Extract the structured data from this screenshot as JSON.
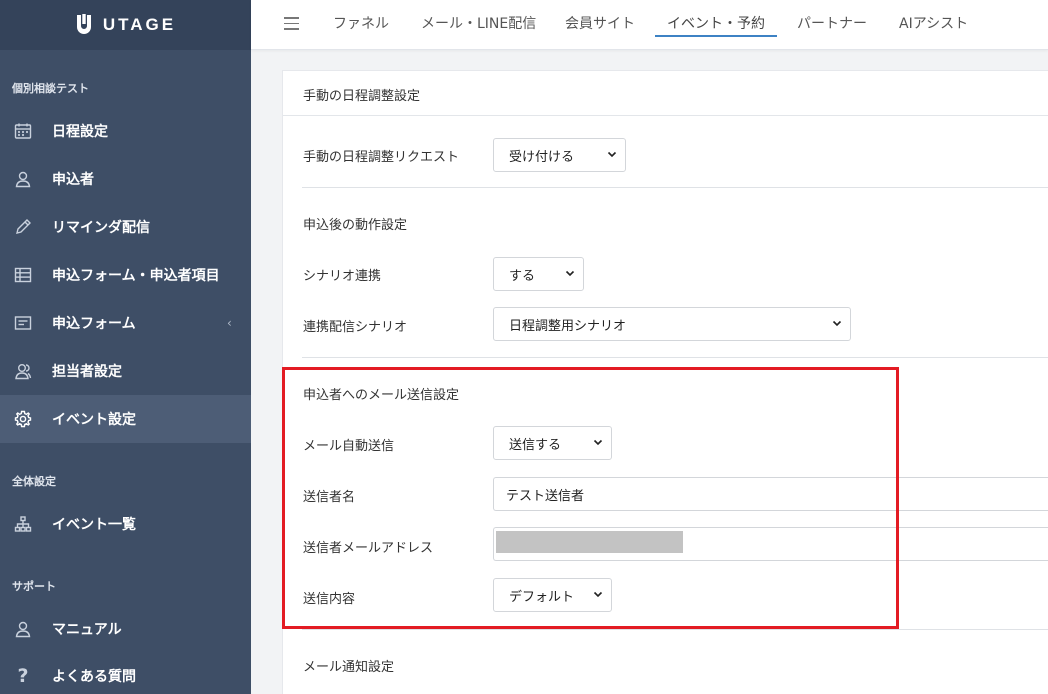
{
  "brand": {
    "name": "UTAGE"
  },
  "sidebar": {
    "sections": [
      {
        "title": "個別相談テスト"
      },
      {
        "title": "全体設定"
      },
      {
        "title": "サポート"
      }
    ],
    "items": [
      {
        "label": "日程設定",
        "icon": "calendar-icon"
      },
      {
        "label": "申込者",
        "icon": "user-icon"
      },
      {
        "label": "リマインダ配信",
        "icon": "pencil-icon"
      },
      {
        "label": "申込フォーム・申込者項目",
        "icon": "table-icon"
      },
      {
        "label": "申込フォーム",
        "icon": "form-icon",
        "chevron": "‹"
      },
      {
        "label": "担当者設定",
        "icon": "users-icon"
      },
      {
        "label": "イベント設定",
        "icon": "gear-icon",
        "active": true
      },
      {
        "label": "イベント一覧",
        "icon": "sitemap-icon"
      },
      {
        "label": "マニュアル",
        "icon": "user-icon"
      },
      {
        "label": "よくある質問",
        "icon": "question-icon"
      }
    ]
  },
  "topnav": {
    "tabs": [
      {
        "label": "ファネル"
      },
      {
        "label": "メール・LINE配信"
      },
      {
        "label": "会員サイト"
      },
      {
        "label": "イベント・予約",
        "active": true
      },
      {
        "label": "パートナー"
      },
      {
        "label": "AIアシスト"
      }
    ]
  },
  "card": {
    "title": "手動の日程調整設定",
    "manual_request": {
      "label": "手動の日程調整リクエスト",
      "value": "受け付ける"
    },
    "after_apply": {
      "heading": "申込後の動作設定",
      "scenario_link": {
        "label": "シナリオ連携",
        "value": "する"
      },
      "scenario": {
        "label": "連携配信シナリオ",
        "value": "日程調整用シナリオ"
      }
    },
    "mail_settings": {
      "heading": "申込者へのメール送信設定",
      "auto_send": {
        "label": "メール自動送信",
        "value": "送信する"
      },
      "sender_name": {
        "label": "送信者名",
        "value": "テスト送信者"
      },
      "sender_email": {
        "label": "送信者メールアドレス",
        "value": ""
      },
      "content": {
        "label": "送信内容",
        "value": "デフォルト"
      }
    },
    "notify_heading": "メール通知設定"
  },
  "colors": {
    "sidebar": "#3e4e66",
    "highlight": "#e31b23",
    "tab_underline": "#3d82c4"
  }
}
